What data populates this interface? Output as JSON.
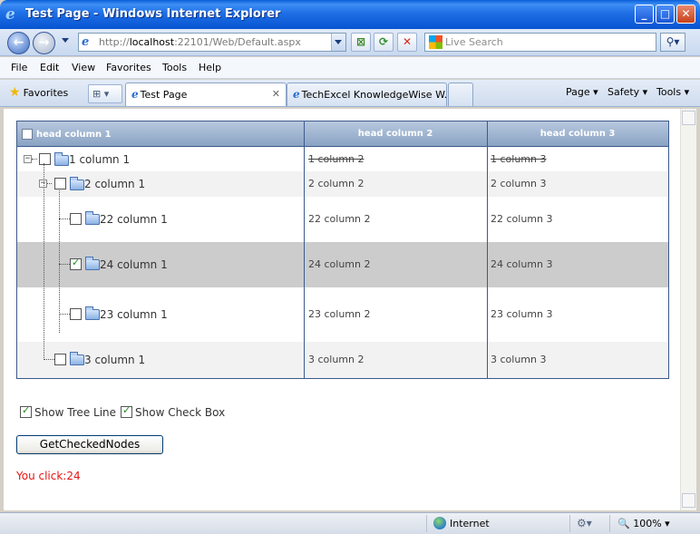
{
  "window": {
    "title": "Test Page - Windows Internet Explorer"
  },
  "address": {
    "url_prefix": "http://",
    "url_host": "localhost",
    "url_rest": ":22101/Web/Default.aspx",
    "search_placeholder": "Live Search"
  },
  "menu": {
    "items": [
      "File",
      "Edit",
      "View",
      "Favorites",
      "Tools",
      "Help"
    ]
  },
  "tabs": {
    "favorites_label": "Favorites",
    "items": [
      {
        "label": "Test Page",
        "active": true
      },
      {
        "label": "TechExcel KnowledgeWise W...",
        "active": false
      }
    ],
    "commands": [
      "Page ▾",
      "Safety ▾",
      "Tools ▾"
    ]
  },
  "grid": {
    "headers": [
      "head column 1",
      "head column 2",
      "head column 3"
    ],
    "rows": [
      {
        "label": "1 column 1",
        "col2": "1 column 2",
        "col3": "1 column 3",
        "checked": false,
        "strike": true
      },
      {
        "label": "2 column 1",
        "col2": "2 column 2",
        "col3": "2 column 3",
        "checked": false,
        "strike": false
      },
      {
        "label": "22 column 1",
        "col2": "22 column 2",
        "col3": "22 column 3",
        "checked": false,
        "strike": false
      },
      {
        "label": "24 column 1",
        "col2": "24 column 2",
        "col3": "24 column 3",
        "checked": true,
        "strike": false,
        "selected": true
      },
      {
        "label": "23 column 1",
        "col2": "23 column 2",
        "col3": "23 column 3",
        "checked": false,
        "strike": false
      },
      {
        "label": "3 column 1",
        "col2": "3 column 2",
        "col3": "3 column 3",
        "checked": false,
        "strike": false
      }
    ]
  },
  "options": {
    "show_tree_line": {
      "label": "Show Tree Line",
      "checked": true
    },
    "show_check_box": {
      "label": "Show Check Box",
      "checked": true
    }
  },
  "button": {
    "label": "GetCheckedNodes"
  },
  "message": "You click:24",
  "status": {
    "zone": "Internet",
    "zoom": "100%"
  },
  "colors": {
    "message": "#e8130f",
    "header_bg": "#8aa3c4",
    "selected_row": "#cccccc"
  }
}
